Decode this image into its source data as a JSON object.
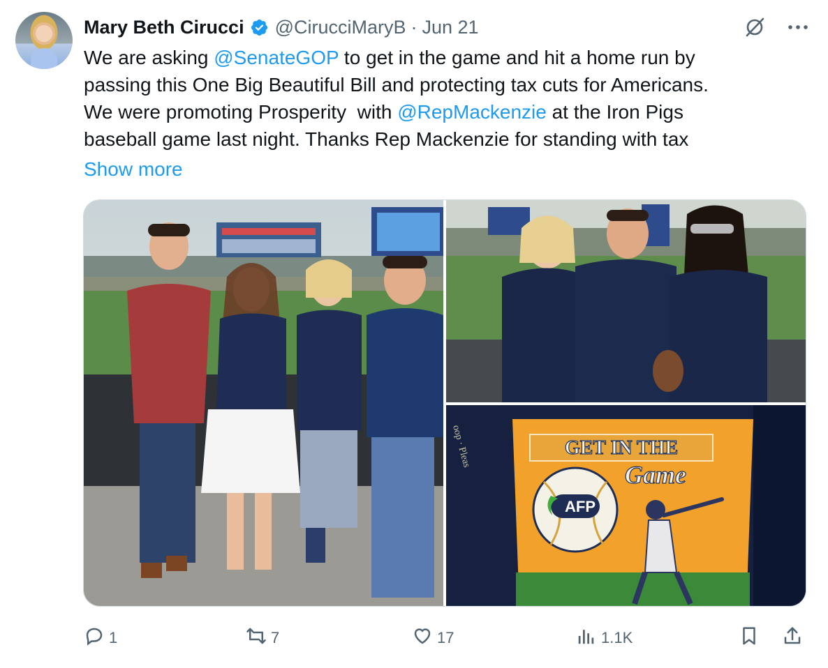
{
  "author": {
    "name": "Mary Beth Cirucci",
    "handle": "@CirucciMaryB",
    "separator": "·",
    "date": "Jun 21",
    "verified": true
  },
  "tweet": {
    "line1_pre": "We are asking ",
    "mention1": "@SenateGOP",
    "line1_post": " to get in the game and hit a home run by",
    "line2": "passing this One Big Beautiful Bill and protecting tax cuts for Americans.",
    "line3_pre": "We were promoting Prosperity  with ",
    "mention2": "@RepMackenzie",
    "line3_post": " at the Iron Pigs",
    "line4": "baseball game last night. Thanks Rep Mackenzie for standing with tax",
    "show_more": "Show more"
  },
  "media": {
    "photos": [
      {
        "id": "photo-1",
        "subject": "four people posing at ballpark"
      },
      {
        "id": "photo-2",
        "subject": "three people at ballpark"
      },
      {
        "id": "photo-3",
        "subject": "Get in the Game AFP t-shirt"
      }
    ],
    "shirt_text": {
      "line1": "GET IN THE",
      "line2": "Game",
      "logo": "AFP"
    }
  },
  "actions": {
    "replies": "1",
    "retweets": "7",
    "likes": "17",
    "views": "1.1K"
  },
  "icons": {
    "verified": "verified-badge-icon",
    "grok": "grok-icon",
    "more": "more-icon",
    "reply": "reply-icon",
    "retweet": "retweet-icon",
    "like": "heart-icon",
    "views": "views-icon",
    "bookmark": "bookmark-icon",
    "share": "share-icon"
  },
  "colors": {
    "accent": "#1d9bf0",
    "text": "#0f1419",
    "secondary": "#536471",
    "border": "#cfd9de"
  }
}
